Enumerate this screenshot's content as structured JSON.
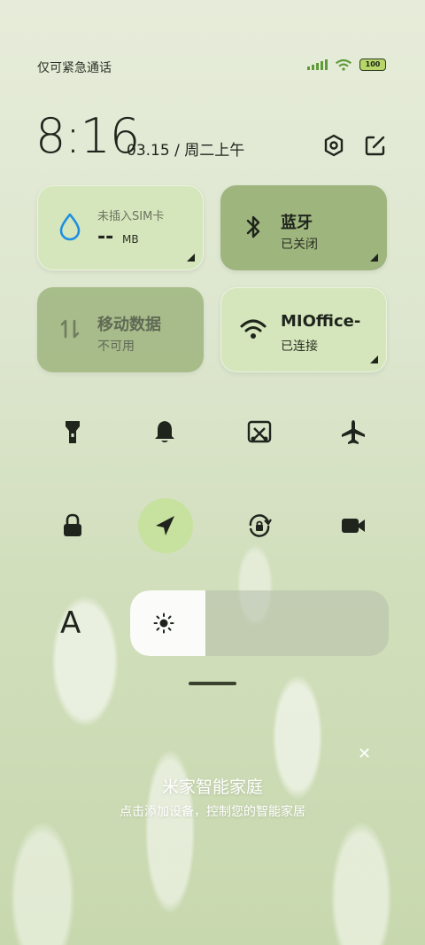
{
  "status_bar": {
    "carrier_text": "仅可紧急通话",
    "battery": "100"
  },
  "clock": {
    "time": "8:16",
    "date": "03.15 / 周二上午"
  },
  "tiles": {
    "data_usage": {
      "title": "未插入SIM卡",
      "value": "--",
      "unit": "MB"
    },
    "bluetooth": {
      "title": "蓝牙",
      "status": "已关闭"
    },
    "mobile_data": {
      "title": "移动数据",
      "status": "不可用"
    },
    "wifi": {
      "title": "MIOffice-",
      "status": "已连接"
    }
  },
  "quick_toggles": [
    "flashlight-icon",
    "bell-icon",
    "screenshot-icon",
    "airplane-icon",
    "lock-icon",
    "location-icon",
    "rotation-lock-icon",
    "video-icon"
  ],
  "brightness": {
    "level": 0.29,
    "font_label": "A"
  },
  "smart_home": {
    "title": "米家智能家庭",
    "subtitle": "点击添加设备，控制您的智能家居"
  },
  "colors": {
    "accent_water": "#1e90e0",
    "location_active": "#c7e19f"
  }
}
